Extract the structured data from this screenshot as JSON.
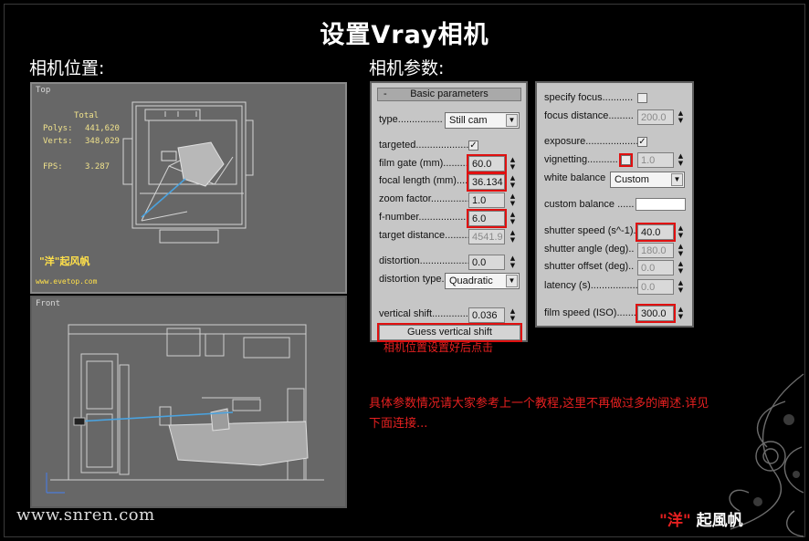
{
  "title": "设置Vray相机",
  "left_label": "相机位置:",
  "right_label": "相机参数:",
  "viewport_top": {
    "label": "Top",
    "stats": {
      "header": "Total",
      "polys_label": "Polys:",
      "polys_value": "441,620",
      "verts_label": "Verts:",
      "verts_value": "348,029",
      "fps_label": "FPS:",
      "fps_value": "3.287"
    },
    "logo_text": "\"洋\"起风帆",
    "logo_url": "www.evetop.com"
  },
  "viewport_front": {
    "label": "Front"
  },
  "basic_params": {
    "header": "Basic parameters",
    "collapse": "-",
    "type_label": "type................",
    "type_value": "Still cam",
    "targeted_label": "targeted...................",
    "targeted_checked": true,
    "film_gate_label": "film gate (mm)...........",
    "film_gate_value": "60.0",
    "focal_length_label": "focal length (mm).....",
    "focal_length_value": "36.134",
    "zoom_factor_label": "zoom factor..............",
    "zoom_factor_value": "1.0",
    "f_number_label": "f-number...................",
    "f_number_value": "6.0",
    "target_distance_label": "target distance.........",
    "target_distance_value": "4541.9",
    "distortion_label": "distortion..................",
    "distortion_value": "0.0",
    "distortion_type_label": "distortion type.",
    "distortion_type_value": "Quadratic",
    "vertical_shift_label": "vertical shift.............",
    "vertical_shift_value": "0.036",
    "guess_button": "Guess vertical shift"
  },
  "right_params": {
    "specify_focus_label": "specify focus...........",
    "specify_focus_checked": false,
    "focus_distance_label": "focus distance.........",
    "focus_distance_value": "200.0",
    "exposure_label": "exposure...................",
    "exposure_checked": true,
    "vignetting_label": "vignetting...........",
    "vignetting_checked": false,
    "vignetting_value": "1.0",
    "white_balance_label": "white balance",
    "white_balance_value": "Custom",
    "custom_balance_label": "custom balance ......",
    "custom_balance_color": "#ffffff",
    "shutter_speed_label": "shutter speed (s^-1).",
    "shutter_speed_value": "40.0",
    "shutter_angle_label": "shutter angle (deg)..",
    "shutter_angle_value": "180.0",
    "shutter_offset_label": "shutter offset (deg)..",
    "shutter_offset_value": "0.0",
    "latency_label": "latency (s).................",
    "latency_value": "0.0",
    "film_speed_label": "film speed (ISO).......",
    "film_speed_value": "300.0"
  },
  "note_button": "相机位置设置好后点击",
  "note_main": "具体参数情况请大家参考上一个教程,这里不再做过多的阐述.详见下面连接...",
  "footer_url": "www.snren.com",
  "footer_sign_q1": "\"洋\"",
  "footer_sign_rest": "起風帆",
  "colors": {
    "highlight": "#e01010",
    "note": "#e62020",
    "panel_bg": "#c6c6c6",
    "viewport_bg": "#676767"
  }
}
